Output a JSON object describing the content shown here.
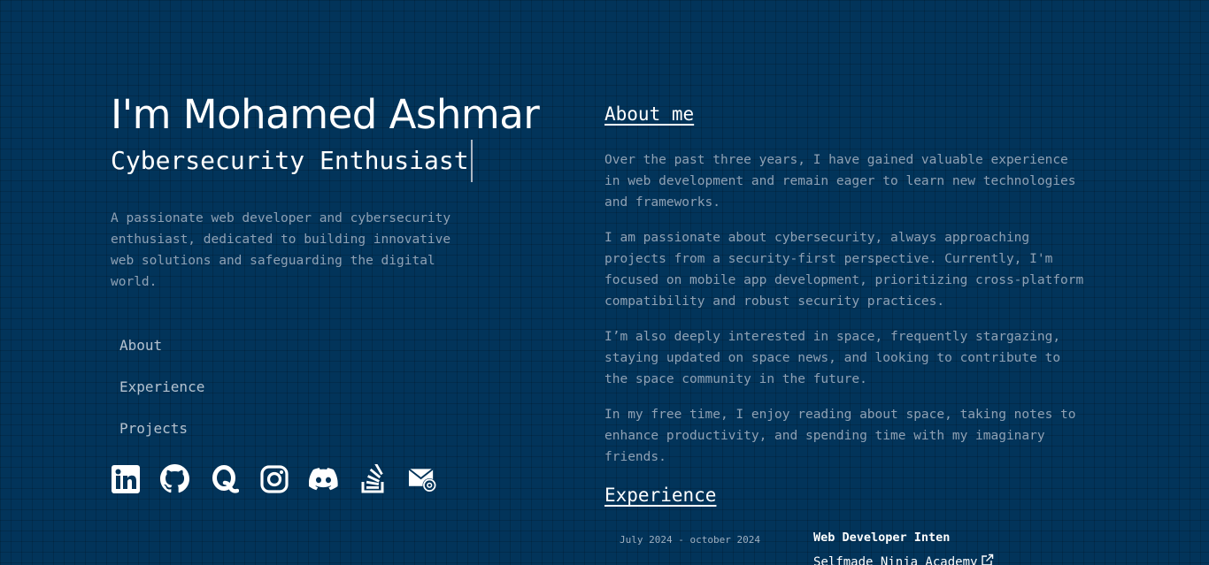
{
  "hero": {
    "name": "I'm Mohamed Ashmar",
    "subtitle": "Cybersecurity Enthusiast",
    "intro": "A passionate web developer and cybersecurity enthusiast, dedicated to building innovative web solutions and safeguarding the digital world."
  },
  "nav": {
    "items": [
      {
        "label": "About"
      },
      {
        "label": "Experience"
      },
      {
        "label": "Projects"
      }
    ]
  },
  "socials": [
    {
      "icon": "linkedin-icon"
    },
    {
      "icon": "github-icon"
    },
    {
      "icon": "quora-icon"
    },
    {
      "icon": "instagram-icon"
    },
    {
      "icon": "discord-icon"
    },
    {
      "icon": "stackoverflow-icon"
    },
    {
      "icon": "email-icon"
    }
  ],
  "about": {
    "heading": "About me",
    "paragraphs": [
      "Over the past three years, I have gained valuable experience in web development and remain eager to learn new technologies and frameworks.",
      "I am passionate about cybersecurity, always approaching projects from a security-first perspective. Currently, I'm focused on mobile app development, prioritizing cross-platform compatibility and robust security practices.",
      "I’m also deeply interested in space, frequently stargazing, staying updated on space news, and looking to contribute to the space community in the future.",
      "In my free time, I enjoy reading about space, taking notes to enhance productivity, and spending time with my imaginary friends."
    ]
  },
  "experience": {
    "heading": "Experience",
    "items": [
      {
        "date": "July 2024 - october 2024",
        "title": "Web Developer Inten",
        "company": "Selfmade Ninja Academy"
      }
    ]
  },
  "colors": {
    "background": "#02345a",
    "text": "#ffffff",
    "muted_text": "#8fa1b4",
    "nav_text": "#b5c2cf"
  }
}
